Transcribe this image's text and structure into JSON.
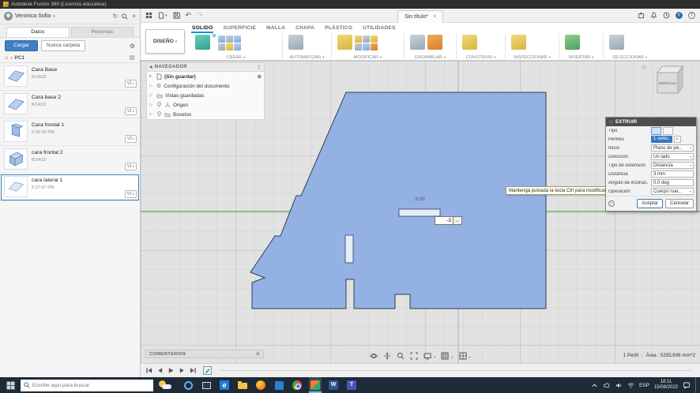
{
  "titlebar": {
    "title": "Autodesk Fusion 360 (Licencia educativa)"
  },
  "icons": {
    "chevron_down": "▾",
    "chevron_right": "›",
    "home": "⌂",
    "gear": "⚙",
    "refresh": "↻",
    "undo": "↶",
    "redo": "↷",
    "close": "×",
    "plus_circle": "⊕",
    "dots": "⋮",
    "tree_collapsed": "▷",
    "tree_open": "▾",
    "help": "?",
    "info": "i",
    "swap": "↔",
    "divider": "|",
    "collapse_left": "◀",
    "user_initial": "V"
  },
  "data_panel": {
    "user": "Veronica Sofia",
    "tabs": [
      {
        "label": "Datos"
      },
      {
        "label": "Personas"
      }
    ],
    "upload_button": "Cargar",
    "new_folder_button": "Nueva carpeta",
    "breadcrumb_root": "PC1",
    "items": [
      {
        "name": "Cara Base",
        "date": "8/14/22",
        "version": "V1"
      },
      {
        "name": "Cara base 2",
        "date": "8/14/22",
        "version": "V1"
      },
      {
        "name": "Cara frontal 1",
        "date": "5:30:30 PM",
        "version": "V2"
      },
      {
        "name": "cara frontal 2",
        "date": "8/14/22",
        "version": "V1"
      },
      {
        "name": "cara lateral 1",
        "date": "5:37:07 PM",
        "version": "V1"
      }
    ]
  },
  "app_bar": {
    "document_tab": "Sin título*"
  },
  "ribbon": {
    "workspace": "DISEÑO",
    "tabs": [
      "SOLIDO",
      "SUPERFICIE",
      "MALLA",
      "CHAPA",
      "PLÁSTICO",
      "UTILIDADES"
    ],
    "groups": [
      "CREAR",
      "AUTOMATIZAR",
      "MODIFICAR",
      "ENSAMBLAR",
      "CONSTRUIR",
      "INSPECCIONAR",
      "INSERTAR",
      "SELECCIONAR"
    ]
  },
  "navigator": {
    "title": "NAVEGADOR",
    "root": "(Sin guardar)",
    "nodes": [
      "Configuración del documento",
      "Vistas guardadas",
      "Origen",
      "Bocetos"
    ]
  },
  "viewcube": {
    "face": "DERECHA"
  },
  "extrude_dialog": {
    "title": "EXTRUIR",
    "rows": [
      {
        "label": "Tipo",
        "value": ""
      },
      {
        "label": "Perfiles",
        "value": "1 selec."
      },
      {
        "label": "Inicio",
        "value": "Plano de pe..."
      },
      {
        "label": "Dirección",
        "value": "Un lado"
      },
      {
        "label": "Tipo de extensión",
        "value": "Distancia"
      },
      {
        "label": "Distancia",
        "value": "3 mm"
      },
      {
        "label": "Ángulo de inclinac.",
        "value": "0.0 deg"
      },
      {
        "label": "Operación",
        "value": "Cuerpo nue..."
      }
    ],
    "ok": "Aceptar",
    "cancel": "Cancelar"
  },
  "canvas": {
    "tooltip": "Mantenga pulsada la tecla Ctrl para modificar la selección.",
    "dim_label": "3.00",
    "dim_input": "-3",
    "comments_label": "COMENTARIOS",
    "selection_info": "1 Perfil",
    "area_info": "Área : 5255.606 mm^2"
  },
  "taskbar": {
    "search_placeholder": "Escribe aquí para buscar",
    "language": "ESP",
    "time": "18:11",
    "date": "15/08/2022"
  },
  "colors": {
    "accent": "#0696d7",
    "selection_blue": "#3d7ab8",
    "sketch_fill": "#93b2e3",
    "axis_green": "#3f9c35"
  }
}
